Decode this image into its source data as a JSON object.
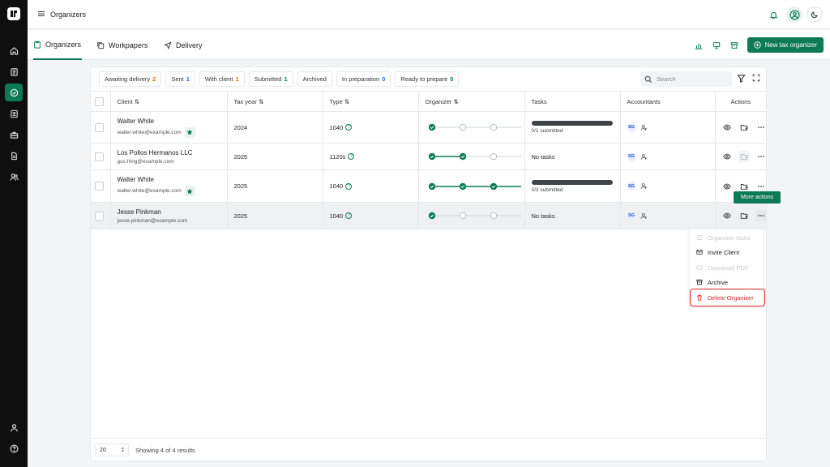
{
  "app": {
    "page_title": "Organizers"
  },
  "tabs": [
    {
      "label": "Organizers"
    },
    {
      "label": "Workpapers"
    },
    {
      "label": "Delivery"
    }
  ],
  "toolbar": {
    "new_button": "New tax organizer"
  },
  "filters": [
    {
      "label": "Awaiting delivery",
      "count": "2",
      "color": "#d97706"
    },
    {
      "label": "Sent",
      "count": "1",
      "color": "#2563eb"
    },
    {
      "label": "With client",
      "count": "1",
      "color": "#d97706"
    },
    {
      "label": "Submitted",
      "count": "1",
      "color": "#0b7a55"
    },
    {
      "label": "Archived",
      "count": "",
      "color": ""
    },
    {
      "label": "In preparation",
      "count": "0",
      "color": "#2563eb"
    },
    {
      "label": "Ready to prepare",
      "count": "0",
      "color": "#0b7a55"
    }
  ],
  "search": {
    "placeholder": "Search"
  },
  "table": {
    "headers": [
      "Client",
      "Tax year",
      "Type",
      "Organizer",
      "Tasks",
      "Accountants",
      "Actions"
    ],
    "rows": [
      {
        "name": "Walter White",
        "email": "walter.white@example.com",
        "starred": true,
        "year": "2024",
        "type": "1040",
        "organizer_steps_done": 1,
        "tasks_bar": true,
        "tasks_text": "0/1 submitted",
        "accountant": "SG"
      },
      {
        "name": "Los Pollos Hermanos LLC",
        "email": "gus.fring@example.com",
        "starred": false,
        "year": "2025",
        "type": "1120s",
        "organizer_steps_done": 2,
        "tasks_bar": false,
        "tasks_text": "No tasks",
        "accountant": "SG"
      },
      {
        "name": "Walter White",
        "email": "walter.white@example.com",
        "starred": true,
        "year": "2025",
        "type": "1040",
        "organizer_steps_done": 4,
        "tasks_bar": true,
        "tasks_text": "0/3 submitted",
        "accountant": "SG"
      },
      {
        "name": "Jesse Pinkman",
        "email": "jesse.pinkman@example.com",
        "starred": false,
        "year": "2025",
        "type": "1040",
        "organizer_steps_done": 1,
        "tasks_bar": false,
        "tasks_text": "No tasks",
        "accountant": "SG"
      }
    ]
  },
  "tooltip": {
    "text": "More actions"
  },
  "menu": {
    "items": [
      {
        "label": "Organizer tasks",
        "disabled": true
      },
      {
        "label": "Invite Client",
        "disabled": false
      },
      {
        "label": "Download PDF",
        "disabled": true
      },
      {
        "label": "Archive",
        "disabled": false
      },
      {
        "label": "Delete Organizer",
        "disabled": false
      }
    ]
  },
  "footer": {
    "page_size": "20",
    "showing": "Showing 4 of 4 results"
  },
  "colors": {
    "brand": "#0b7a55",
    "danger": "#dc2626"
  }
}
